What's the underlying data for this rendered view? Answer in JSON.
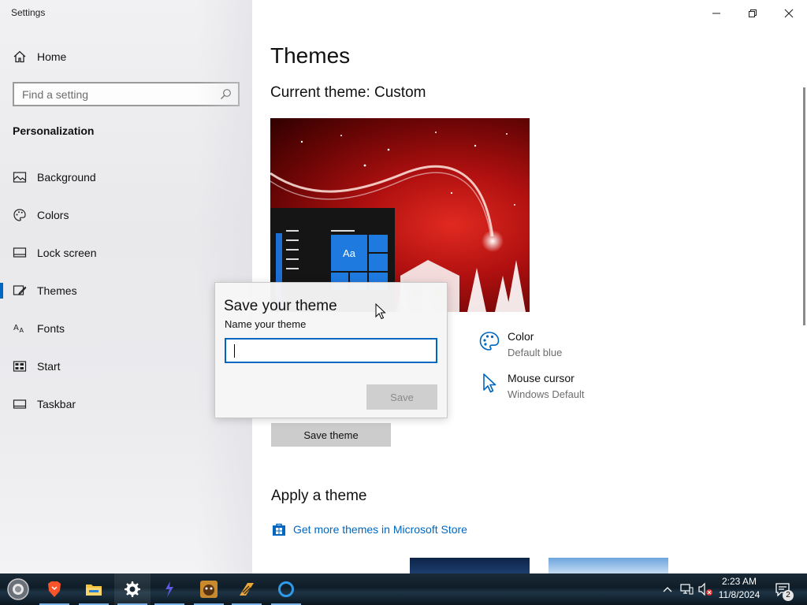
{
  "window": {
    "title": "Settings"
  },
  "sidebar": {
    "home_label": "Home",
    "search_placeholder": "Find a setting",
    "section_label": "Personalization",
    "items": [
      {
        "label": "Background",
        "icon": "picture-icon"
      },
      {
        "label": "Colors",
        "icon": "palette-icon"
      },
      {
        "label": "Lock screen",
        "icon": "lock-screen-icon"
      },
      {
        "label": "Themes",
        "icon": "brush-icon",
        "active": true
      },
      {
        "label": "Fonts",
        "icon": "font-icon"
      },
      {
        "label": "Start",
        "icon": "start-icon"
      },
      {
        "label": "Taskbar",
        "icon": "taskbar-icon"
      }
    ]
  },
  "main": {
    "title": "Themes",
    "current_theme": "Current theme: Custom",
    "preview_tile_text": "Aa",
    "color": {
      "label": "Color",
      "value": "Default blue"
    },
    "cursor": {
      "label": "Mouse cursor",
      "value": "Windows Default"
    },
    "save_theme_button": "Save theme",
    "apply_heading": "Apply a theme",
    "store_link": "Get more themes in Microsoft Store"
  },
  "dialog": {
    "title": "Save your theme",
    "label": "Name your theme",
    "input_value": "",
    "save_button": "Save"
  },
  "taskbar": {
    "time": "2:23 AM",
    "date": "11/8/2024",
    "notification_count": "2",
    "apps": [
      "start-orb-icon",
      "brave-icon",
      "file-explorer-icon",
      "settings-gear-icon",
      "app-icon",
      "game-icon",
      "media-icon",
      "browser-icon"
    ]
  },
  "colors": {
    "accent": "#0067c0",
    "link": "#0067c0",
    "taskbar": "#0f1d28"
  }
}
